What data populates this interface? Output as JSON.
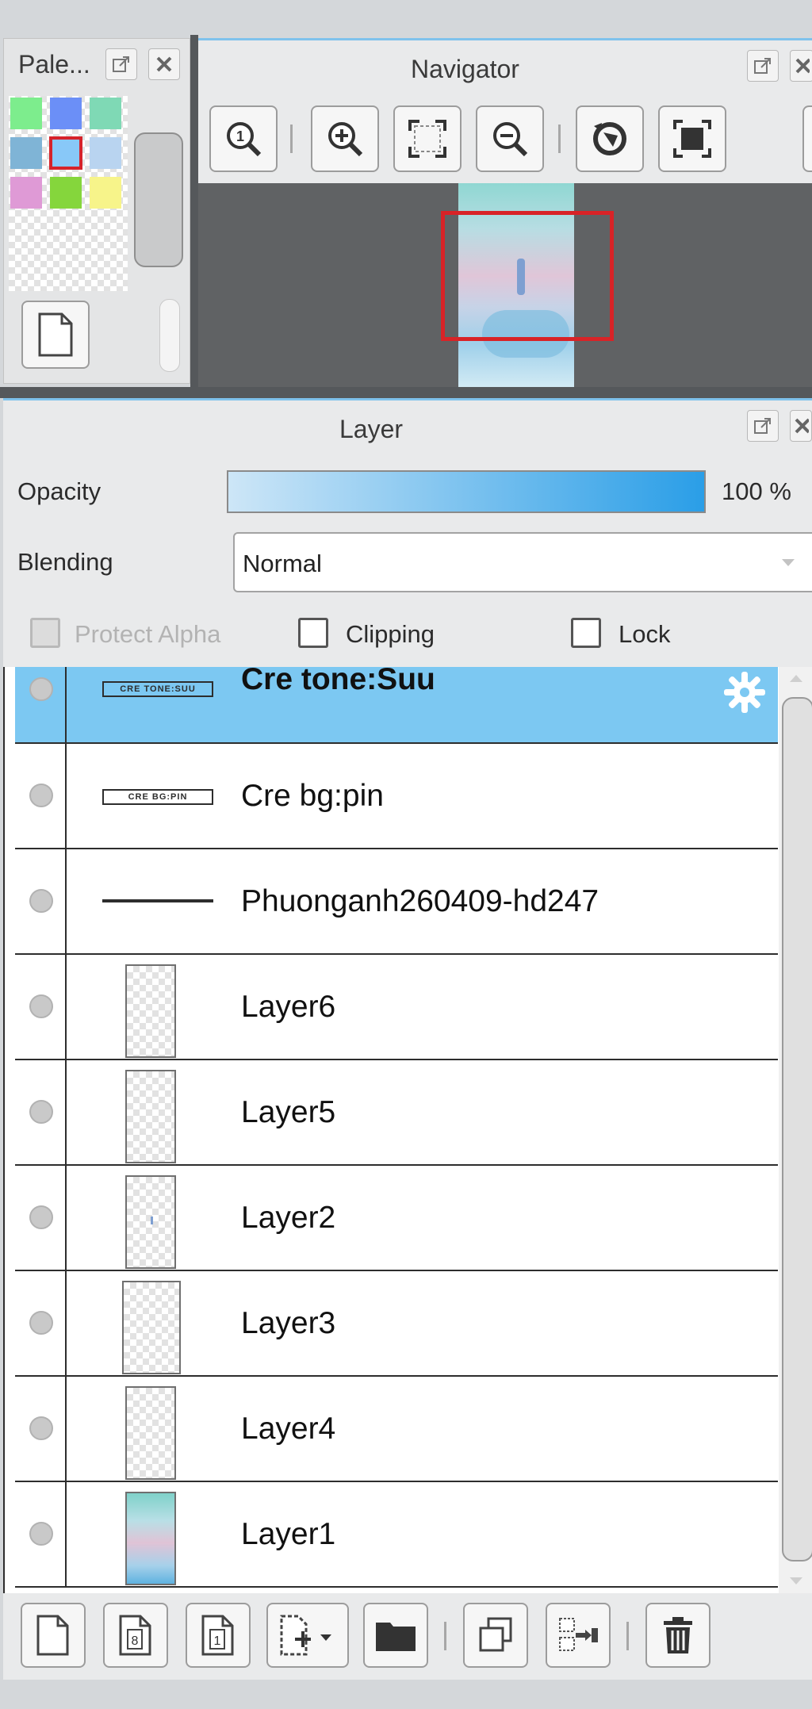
{
  "palette": {
    "title": "Pale...",
    "swatches": [
      "#7ded8d",
      "#6b8ff7",
      "#7fd9b5",
      "#7fb4d6",
      "#88c8f8",
      "#b9d4f0",
      "#df9ad6",
      "#85d63c",
      "#f7f48a"
    ]
  },
  "navigator": {
    "title": "Navigator"
  },
  "layer": {
    "title": "Layer",
    "opacity_label": "Opacity",
    "opacity_value": "100 %",
    "opacity": 1.0,
    "blending_label": "Blending",
    "blending_value": "Normal",
    "protect_alpha": "Protect Alpha",
    "clipping": "Clipping",
    "lock": "Lock",
    "rows": [
      {
        "name": "Cre tone:Suu"
      },
      {
        "name": "Cre bg:pin"
      },
      {
        "name": "Phuonganh260409-hd247"
      },
      {
        "name": "Layer6"
      },
      {
        "name": "Layer5"
      },
      {
        "name": "Layer2"
      },
      {
        "name": "Layer3"
      },
      {
        "name": "Layer4"
      },
      {
        "name": "Layer1"
      }
    ],
    "thumb_texts": [
      "CRE TONE:SUU",
      "CRE BG:PIN"
    ]
  },
  "icons": {
    "close": "close-icon",
    "popout": "popout-icon",
    "zoom_actual": "zoom-actual-icon",
    "zoom_in": "zoom-in-icon",
    "fit": "fit-icon",
    "zoom_out": "zoom-out-icon",
    "rotate": "rotate-icon",
    "fullscreen": "fullscreen-icon",
    "new_layer": "new-layer-icon",
    "new_8bit": "new-8bit-layer-icon",
    "new_1bit": "new-1bit-layer-icon",
    "add_more": "add-layer-dropdown-icon",
    "folder": "folder-icon",
    "duplicate": "duplicate-icon",
    "merge": "merge-down-icon",
    "delete": "trash-icon",
    "gear": "gear-icon"
  },
  "colors": {
    "selected_row": "#7cc8f2",
    "accent": "#2aa3ea"
  },
  "footer_buttons": {
    "eight": "8",
    "one": "1"
  }
}
